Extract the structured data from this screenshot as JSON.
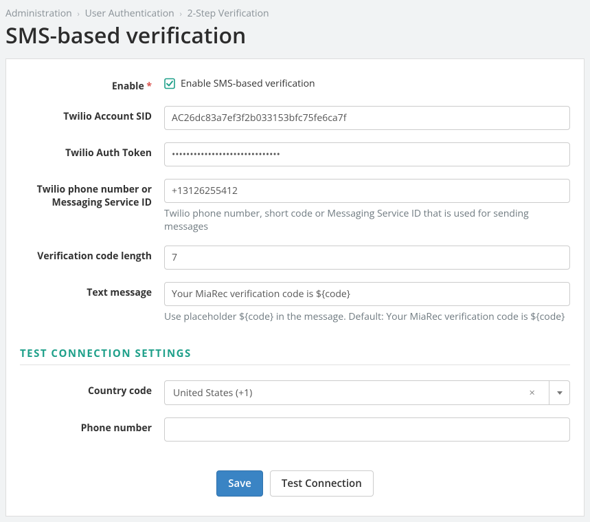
{
  "breadcrumb": {
    "items": [
      "Administration",
      "User Authentication",
      "2-Step Verification"
    ]
  },
  "title": "SMS-based verification",
  "form": {
    "enable_label": "Enable",
    "enable_checkbox_label": "Enable SMS-based verification",
    "enable_checked": true,
    "twilio_sid_label": "Twilio Account SID",
    "twilio_sid_value": "AC26dc83a7ef3f2b033153bfc75fe6ca7f",
    "twilio_token_label": "Twilio Auth Token",
    "twilio_token_value": "••••••••••••••••••••••••••••••",
    "twilio_phone_label": "Twilio phone number or Messaging Service ID",
    "twilio_phone_value": "+13126255412",
    "twilio_phone_help": "Twilio phone number, short code or Messaging Service ID that is used for sending messages",
    "code_length_label": "Verification code length",
    "code_length_value": "7",
    "text_msg_label": "Text message",
    "text_msg_value": "Your MiaRec verification code is ${code}",
    "text_msg_help": "Use placeholder ${code} in the message. Default: Your MiaRec verification code is ${code}"
  },
  "test_section": {
    "header": "TEST CONNECTION SETTINGS",
    "country_code_label": "Country code",
    "country_code_value": "United States (+1)",
    "phone_number_label": "Phone number",
    "phone_number_value": ""
  },
  "actions": {
    "save": "Save",
    "test": "Test Connection"
  }
}
